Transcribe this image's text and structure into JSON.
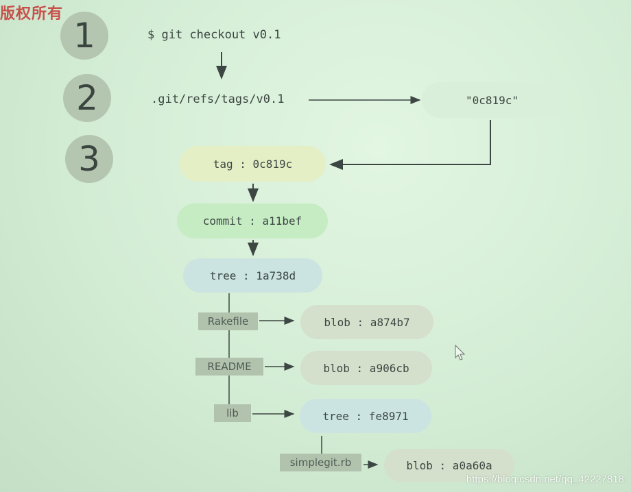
{
  "watermark": "版权所有",
  "steps": [
    "1",
    "2",
    "3"
  ],
  "command": "$ git checkout v0.1",
  "ref_path": ".git/refs/tags/v0.1",
  "ref_value": "\"0c819c\"",
  "nodes": {
    "tag": "tag : 0c819c",
    "commit": "commit : a11bef",
    "tree": "tree : 1a738d",
    "blob_rakefile": "blob : a874b7",
    "blob_readme": "blob : a906cb",
    "tree_lib": "tree : fe8971",
    "blob_simplegit": "blob : a0a60a"
  },
  "entries": {
    "rakefile": "Rakefile",
    "readme": "README",
    "lib": "lib",
    "simplegit": "simplegit.rb"
  },
  "colors": {
    "tag": "#e4efc6",
    "commit": "#c6ecc4",
    "tree": "#cbe4e2",
    "blob": "#d5e0cc",
    "step": "#b4c5b0"
  },
  "footer_url": "https://blog.csdn.net/qq_42227818"
}
